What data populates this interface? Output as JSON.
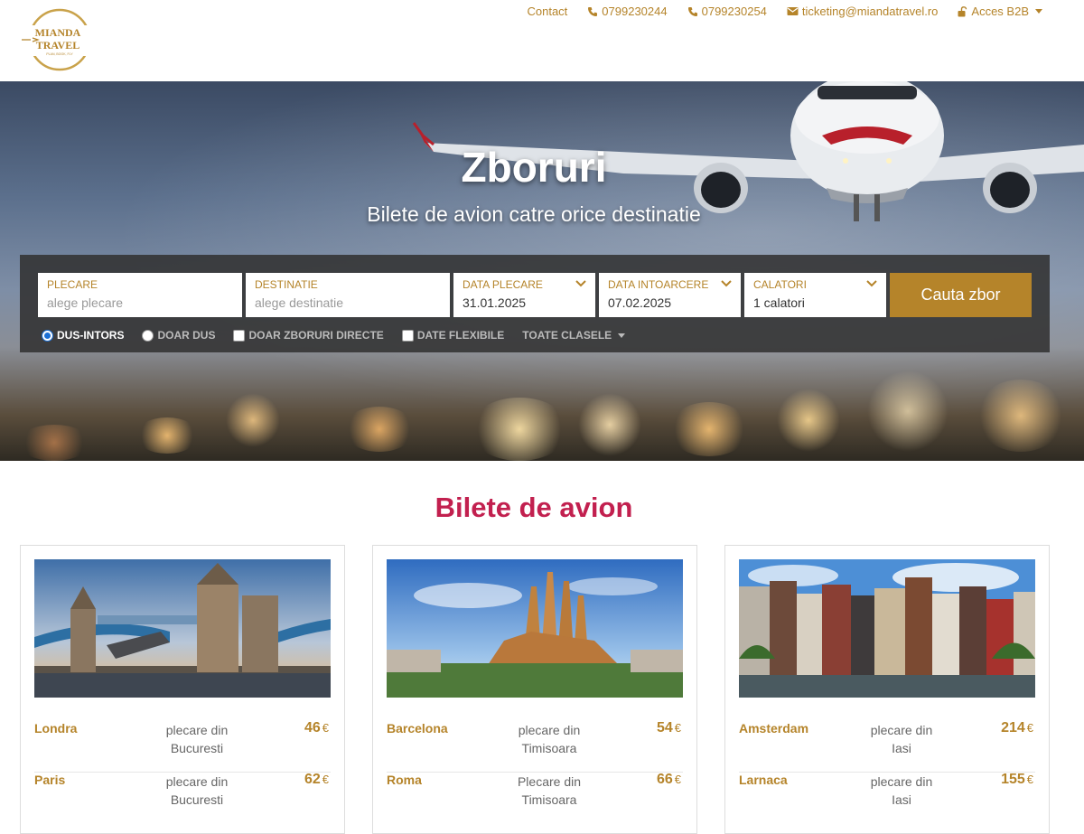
{
  "brand": {
    "name_line1": "MIANDA",
    "name_line2": "TRAVEL",
    "tagline": "PLAN, BOOK, FLY",
    "gold": "#b5842a"
  },
  "topnav": {
    "contact": "Contact",
    "phone1": "0799230244",
    "phone2": "0799230254",
    "email": "ticketing@miandatravel.ro",
    "b2b": "Acces B2B",
    "icons": [
      "phone-icon",
      "phone-icon",
      "envelope-icon",
      "unlock-icon"
    ]
  },
  "hero": {
    "title": "Zboruri",
    "subtitle": "Bilete de avion catre orice destinatie"
  },
  "search": {
    "departure": {
      "label": "PLECARE",
      "placeholder": "alege plecare"
    },
    "destination": {
      "label": "DESTINATIE",
      "placeholder": "alege destinatie"
    },
    "depart_date": {
      "label": "DATA PLECARE",
      "value": "31.01.2025"
    },
    "return_date": {
      "label": "DATA INTOARCERE",
      "value": "07.02.2025"
    },
    "travelers": {
      "label": "CALATORI",
      "value": "1 calatori"
    },
    "submit": "Cauta zbor",
    "options": {
      "round_trip": "DUS-INTORS",
      "one_way": "DOAR DUS",
      "direct_only": "DOAR ZBORURI DIRECTE",
      "flexible": "DATE FLEXIBILE",
      "classes": "TOATE CLASELE"
    },
    "selected_trip": "round_trip"
  },
  "section": {
    "title": "Bilete de avion",
    "title_color": "#c2204f"
  },
  "cards": [
    {
      "photo": "london-tower-bridge",
      "rows": [
        {
          "city": "Londra",
          "from_label": "plecare din",
          "from_city": "Bucuresti",
          "price": "46",
          "currency": "€"
        },
        {
          "city": "Paris",
          "from_label": "plecare din",
          "from_city": "Bucuresti",
          "price": "62",
          "currency": "€"
        }
      ]
    },
    {
      "photo": "barcelona-sagrada-familia",
      "rows": [
        {
          "city": "Barcelona",
          "from_label": "plecare din",
          "from_city": "Timisoara",
          "price": "54",
          "currency": "€"
        },
        {
          "city": "Roma",
          "from_label": "Plecare din",
          "from_city": "Timisoara",
          "price": "66",
          "currency": "€"
        }
      ]
    },
    {
      "photo": "amsterdam-canal-houses",
      "rows": [
        {
          "city": "Amsterdam",
          "from_label": "plecare din",
          "from_city": "Iasi",
          "price": "214",
          "currency": "€"
        },
        {
          "city": "Larnaca",
          "from_label": "plecare din",
          "from_city": "Iasi",
          "price": "155",
          "currency": "€"
        }
      ]
    }
  ]
}
